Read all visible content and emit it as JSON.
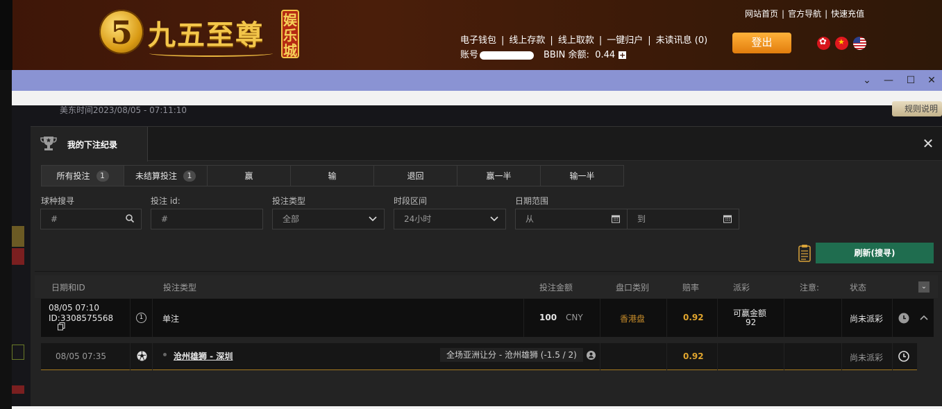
{
  "site": {
    "brand": "九五至尊",
    "tag": "娱乐城",
    "logo_digit": "5",
    "top_links": [
      "网站首页",
      "官方导航",
      "快速充值"
    ],
    "wallet_links": [
      "电子钱包",
      "线上存款",
      "线上取款",
      "一键归户",
      "未读讯息 (0)"
    ],
    "account_label": "账号",
    "balance_label": "BBIN 余额:",
    "balance_value": "0.44",
    "logout_label": "登出",
    "flags": [
      "hk-flag",
      "cn-flag",
      "us-flag"
    ]
  },
  "background_app": {
    "time_text": "美东时间2023/08/05 - 07:11:10",
    "rules_button": "规则说明"
  },
  "modal": {
    "title": "我的下注纪录",
    "tabs": [
      {
        "label": "所有投注",
        "count": "1"
      },
      {
        "label": "未结算投注",
        "count": "1"
      },
      {
        "label": "赢"
      },
      {
        "label": "输"
      },
      {
        "label": "退回"
      },
      {
        "label": "赢一半"
      },
      {
        "label": "输一半"
      }
    ],
    "filters": {
      "sport_search": {
        "label": "球种搜寻",
        "value": "#"
      },
      "bet_id": {
        "label": "投注 id:",
        "value": "#"
      },
      "bet_type": {
        "label": "投注类型",
        "value": "全部"
      },
      "time_range": {
        "label": "时段区间",
        "value": "24小时"
      },
      "date_range": {
        "label": "日期范围",
        "from": "从",
        "to": "到"
      }
    },
    "refresh_button": "刷新(搜寻)",
    "columns": {
      "date_id": "日期和ID",
      "bet_type": "投注类型",
      "amount": "投注金额",
      "odds_type": "盘口类别",
      "odds": "赔率",
      "payout": "派彩",
      "note": "注意:",
      "status": "状态"
    },
    "bet": {
      "date": "08/05 07:10",
      "id_label": "ID:",
      "id": "3308575568",
      "legs": "1",
      "type": "单注",
      "amount": "100",
      "currency": "CNY",
      "odds_type": "香港盘",
      "odds": "0.92",
      "payout_label": "可赢金额",
      "payout": "92",
      "status": "尚未派彩"
    },
    "leg": {
      "date": "08/05 07:35",
      "match": "沧州雄狮 - 深圳",
      "market": "全场亚洲让分 - 沧州雄狮 (-1.5 / 2)",
      "odds": "0.92",
      "status": "尚未派彩"
    }
  },
  "colors": {
    "header_bg": "#3e1608",
    "accent_gold": "#e0a52e",
    "refresh_green": "#1f6d4f",
    "logout_orange": "#f29a20",
    "window_bar": "#8a93d3"
  }
}
